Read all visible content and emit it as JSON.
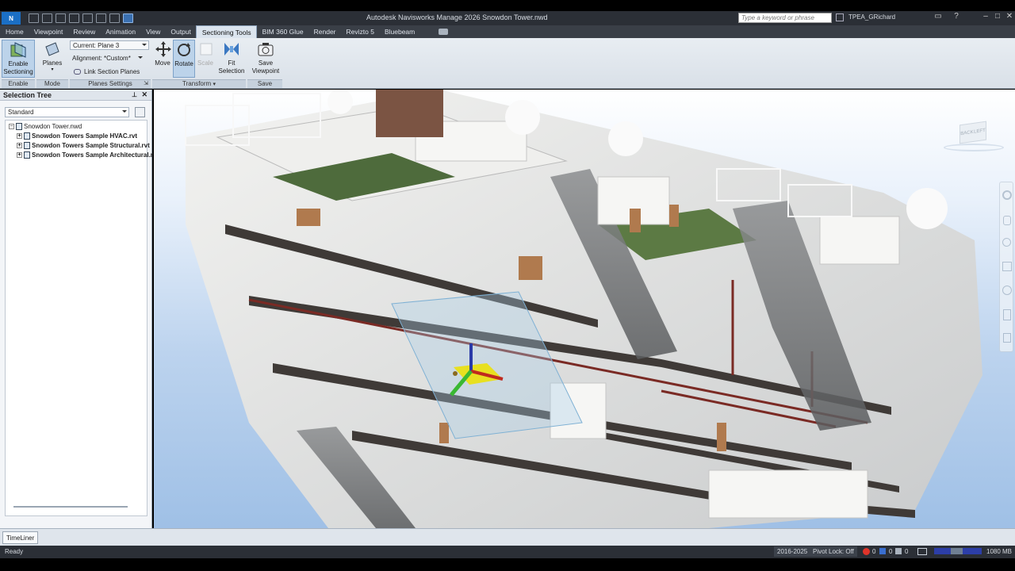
{
  "title_bar": {
    "app_logo": "N",
    "title": "Autodesk Navisworks Manage 2026    Snowdon Tower.nwd",
    "search_placeholder": "Type a keyword or phrase",
    "user": "TPEA_GRichard"
  },
  "ribbon_tabs": [
    "Home",
    "Viewpoint",
    "Review",
    "Animation",
    "View",
    "Output",
    "Sectioning Tools",
    "BIM 360 Glue",
    "Render",
    "Revizto 5",
    "Bluebeam"
  ],
  "ribbon": {
    "enable_sectioning": "Enable\nSectioning",
    "planes": "Planes",
    "current_plane": "Current: Plane 3",
    "alignment": "Alignment: *Custom*",
    "link_section_planes": "Link Section Planes",
    "move": "Move",
    "rotate": "Rotate",
    "scale": "Scale",
    "fit_selection": "Fit\nSelection",
    "save_viewpoint": "Save\nViewpoint",
    "groups": {
      "enable": "Enable",
      "mode": "Mode",
      "planes_settings": "Planes Settings",
      "transform": "Transform",
      "save": "Save"
    }
  },
  "selection_tree": {
    "title": "Selection Tree",
    "filter": "Standard",
    "root": "Snowdon Tower.nwd",
    "children": [
      "Snowdon Towers Sample HVAC.rvt",
      "Snowdon Towers Sample Structural.rvt",
      "Snowdon Towers Sample Architectural.r"
    ]
  },
  "viewcube": {
    "back_label": "BACK",
    "left_label": "LEFT"
  },
  "bottom": {
    "timeliner_tab": "TimeLiner",
    "status_ready": "Ready",
    "sheet_info": "2016-2025",
    "pivot_lock": "Pivot Lock: Off",
    "counter_a": "0",
    "counter_b": "0",
    "counter_c": "0",
    "memory": "1080 MB"
  },
  "colors": {
    "titlebar": "#2b2f36",
    "ribbon_bg": "#dde4eb",
    "active_tab": "#dbe4ee",
    "sky_top": "#ffffff",
    "sky_bottom": "#9fc0e6",
    "gizmo_yellow": "#e8e020",
    "gizmo_green": "#3ab832"
  }
}
